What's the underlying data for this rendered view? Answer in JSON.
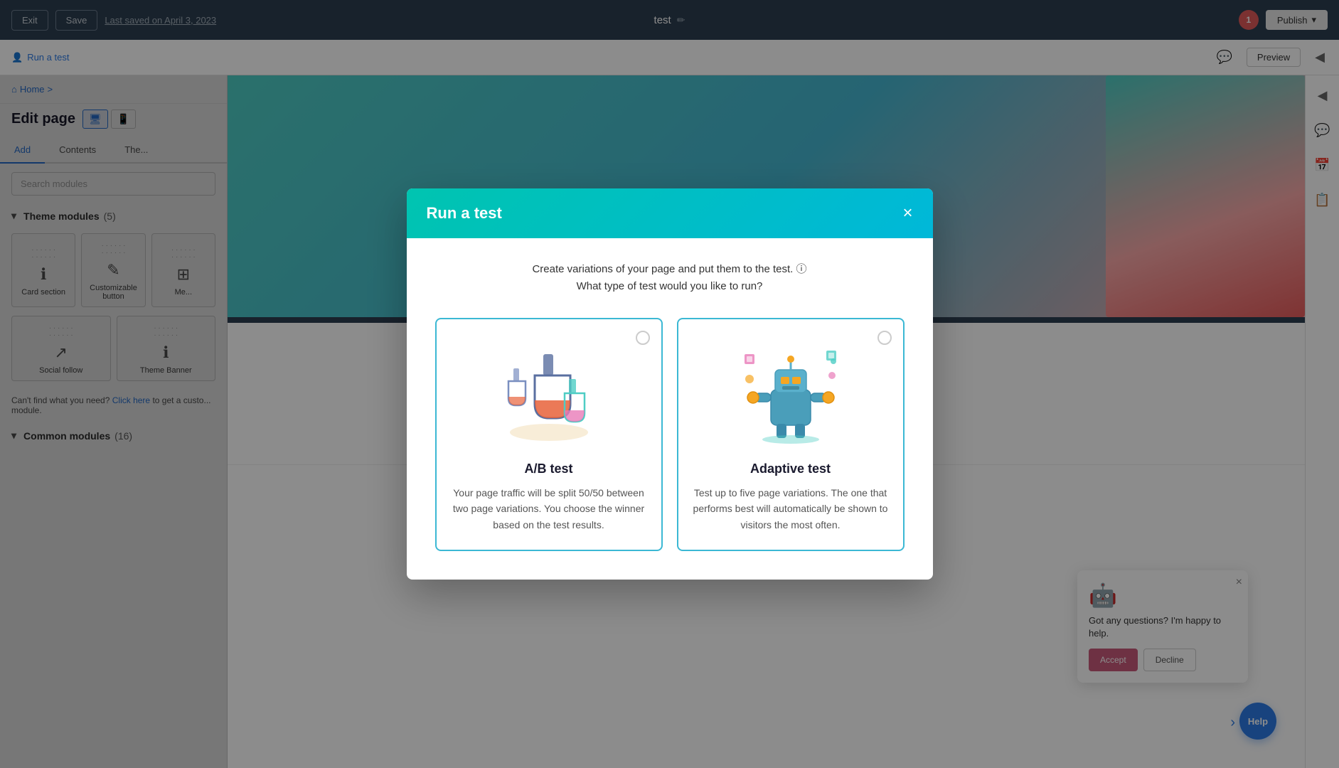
{
  "topbar": {
    "exit_label": "Exit",
    "save_label": "Save",
    "last_saved": "Last saved on April 3, 2023",
    "page_name": "test",
    "publish_label": "Publish",
    "avatar_initials": "1"
  },
  "subbar": {
    "run_test_label": "Run a test",
    "preview_label": "Preview"
  },
  "sidebar": {
    "breadcrumb_home": "Home",
    "breadcrumb_sep": ">",
    "page_title": "Edit page",
    "tabs": [
      {
        "label": "Add",
        "active": true
      },
      {
        "label": "Contents",
        "active": false
      },
      {
        "label": "The...",
        "active": false
      }
    ],
    "search_placeholder": "Search modules",
    "theme_section": {
      "label": "Theme modules",
      "count": "(5)",
      "modules": [
        {
          "label": "Card section",
          "icon": "ℹ"
        },
        {
          "label": "Customizable button",
          "icon": "✎"
        },
        {
          "label": "Me...",
          "icon": "⊞"
        },
        {
          "label": "Social follow",
          "icon": "↗"
        },
        {
          "label": "Theme Banner",
          "icon": "ℹ"
        }
      ]
    },
    "cant_find_text": "Can't find what you need?",
    "click_here_label": "Click here",
    "cant_find_suffix": " to get a custo... module.",
    "common_section": {
      "label": "Common modules",
      "count": "(16)"
    }
  },
  "modal": {
    "title": "Run a test",
    "close_label": "×",
    "subtitle_line1": "Create variations of your page and put them to the test.",
    "subtitle_line2": "What type of test would you like to run?",
    "info_icon": "ⓘ",
    "ab_test": {
      "title": "A/B test",
      "description": "Your page traffic will be split 50/50 between two page variations. You choose the winner based on the test results."
    },
    "adaptive_test": {
      "title": "Adaptive test",
      "description": "Test up to five page variations. The one that performs best will automatically be shown to visitors the most often."
    }
  },
  "chat": {
    "text": "Got any questions? I'm happy to help.",
    "accept_label": "Accept",
    "decline_label": "Decline",
    "help_label": "Help"
  },
  "colors": {
    "teal_gradient_start": "#00c4b0",
    "teal_gradient_end": "#00b8d9",
    "blue_accent": "#2c7be5",
    "card_border": "#3bb8d4",
    "topbar_bg": "#2d3e50"
  }
}
